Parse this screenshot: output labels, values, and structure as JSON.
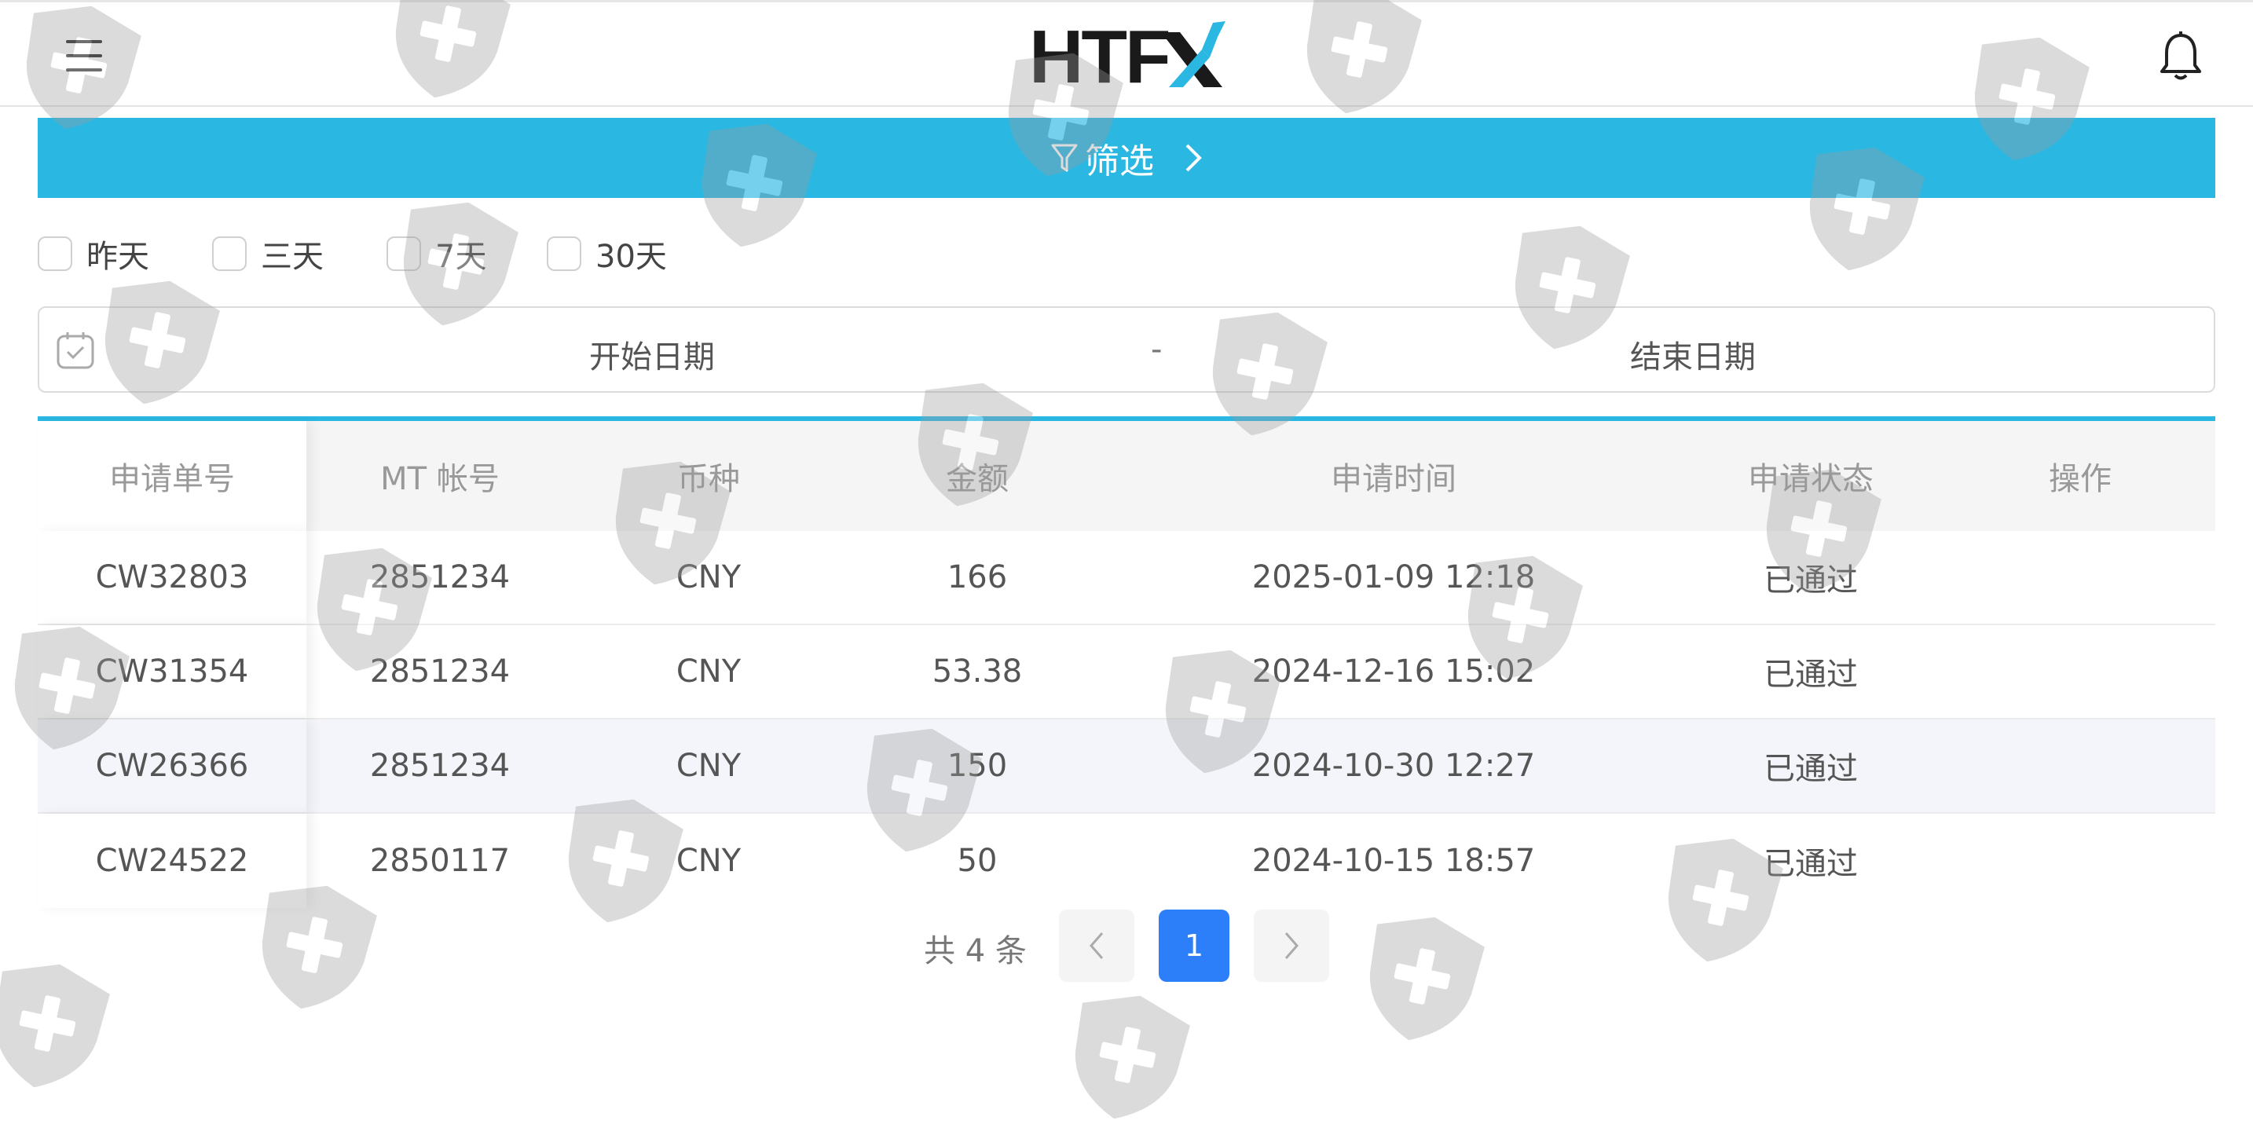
{
  "header": {
    "logo_text": "HTF",
    "menu_icon": "hamburger-menu-icon",
    "bell_icon": "bell-icon"
  },
  "filter": {
    "label": "筛选",
    "icons": [
      "funnel-icon",
      "chevron-right-icon"
    ],
    "bar_color": "#2ab8e3"
  },
  "quick_ranges": [
    {
      "label": "昨天",
      "checked": false
    },
    {
      "label": "三天",
      "checked": false
    },
    {
      "label": "7天",
      "checked": false
    },
    {
      "label": "30天",
      "checked": false
    }
  ],
  "date_range": {
    "start_placeholder": "开始日期",
    "separator": "-",
    "end_placeholder": "结束日期",
    "icon": "calendar-icon"
  },
  "table": {
    "columns": [
      "申请单号",
      "MT 帐号",
      "币种",
      "金额",
      "申请时间",
      "申请状态",
      "操作"
    ],
    "rows": [
      {
        "id": "CW32803",
        "account": "2851234",
        "currency": "CNY",
        "amount": "166",
        "time": "2025-01-09 12:18",
        "status": "已通过",
        "action": ""
      },
      {
        "id": "CW31354",
        "account": "2851234",
        "currency": "CNY",
        "amount": "53.38",
        "time": "2024-12-16 15:02",
        "status": "已通过",
        "action": ""
      },
      {
        "id": "CW26366",
        "account": "2851234",
        "currency": "CNY",
        "amount": "150",
        "time": "2024-10-30 12:27",
        "status": "已通过",
        "action": ""
      },
      {
        "id": "CW24522",
        "account": "2850117",
        "currency": "CNY",
        "amount": "50",
        "time": "2024-10-15 18:57",
        "status": "已通过",
        "action": ""
      }
    ]
  },
  "pagination": {
    "total_text": "共 4 条",
    "current_page": "1",
    "prev_icon": "chevron-left-icon",
    "next_icon": "chevron-right-icon",
    "active_color": "#2d7ff9"
  },
  "watermark_icon": "shield-plus-icon"
}
